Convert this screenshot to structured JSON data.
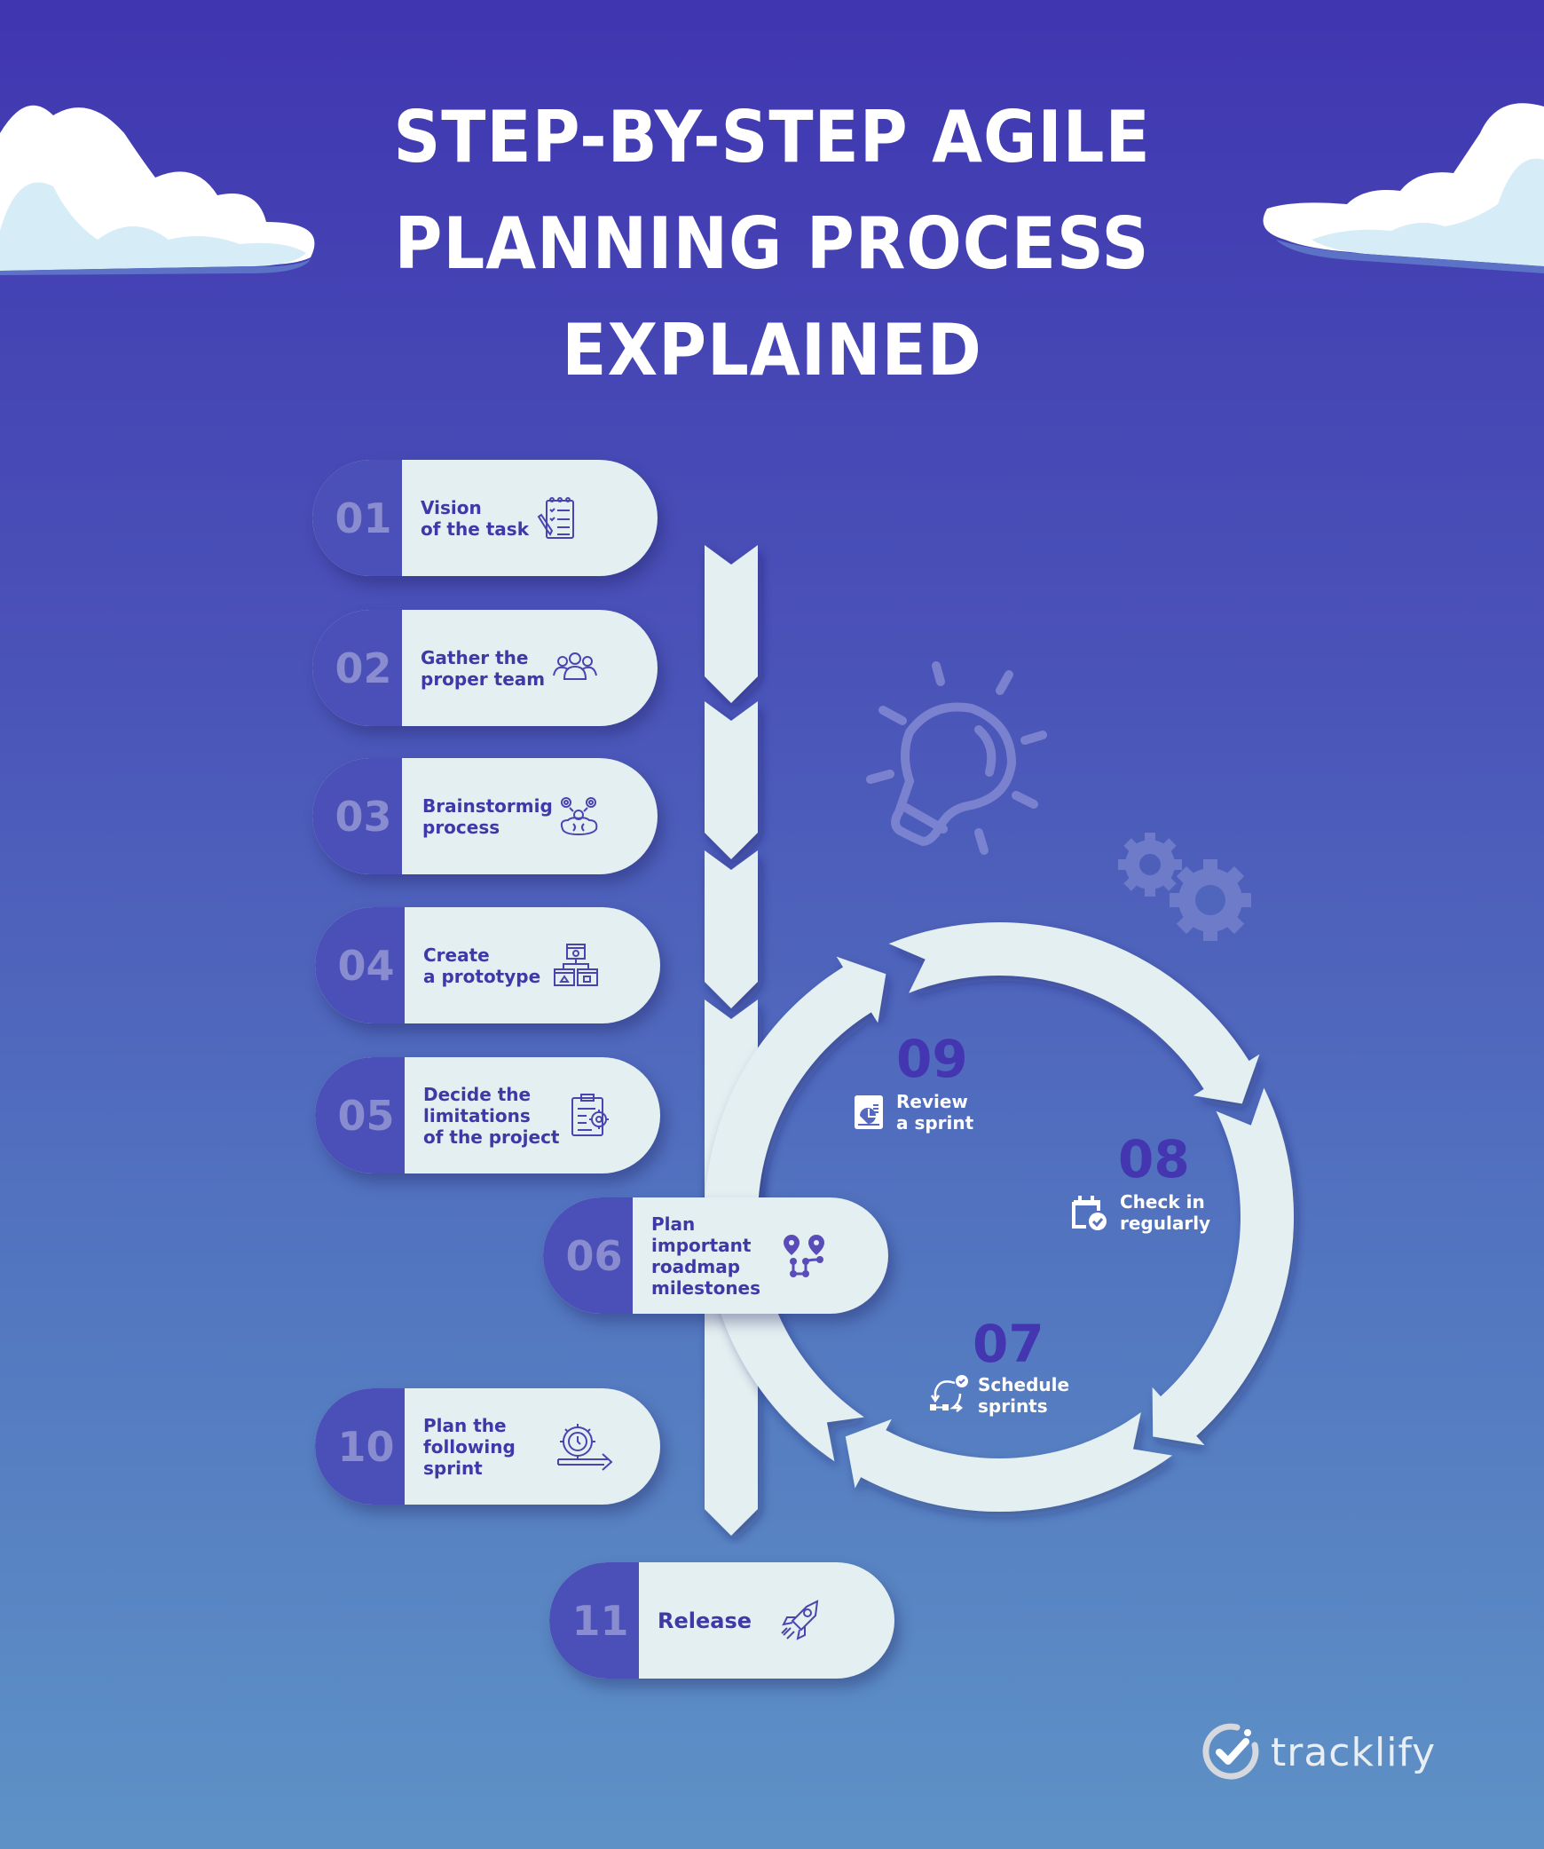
{
  "title": {
    "line1": "STEP-BY-STEP AGILE",
    "line2": "PLANNING PROCESS",
    "line3": "EXPLAINED"
  },
  "steps": [
    {
      "num": "01",
      "lines": [
        "Vision",
        "of the task"
      ],
      "icon": "checklist-notepad-icon"
    },
    {
      "num": "02",
      "lines": [
        "Gather the",
        "proper team"
      ],
      "icon": "team-people-icon"
    },
    {
      "num": "03",
      "lines": [
        "Brainstormig",
        "process"
      ],
      "icon": "brain-gears-icon"
    },
    {
      "num": "04",
      "lines": [
        "Create",
        "a prototype"
      ],
      "icon": "prototype-hierarchy-icon"
    },
    {
      "num": "05",
      "lines": [
        "Decide the",
        "limitations",
        "of the project"
      ],
      "icon": "clipboard-gear-icon"
    },
    {
      "num": "06",
      "lines": [
        "Plan",
        "important",
        "roadmap",
        "milestones"
      ],
      "icon": "roadmap-pins-icon"
    },
    {
      "num": "10",
      "lines": [
        "Plan the",
        "following",
        "sprint"
      ],
      "icon": "gear-clock-arrow-icon"
    },
    {
      "num": "11",
      "lines": [
        "Release"
      ],
      "icon": "rocket-icon"
    }
  ],
  "cycle": [
    {
      "num": "07",
      "lines": [
        "Schedule",
        "sprints"
      ],
      "icon": "schedule-cycle-icon"
    },
    {
      "num": "08",
      "lines": [
        "Check in",
        "regularly"
      ],
      "icon": "calendar-check-icon"
    },
    {
      "num": "09",
      "lines": [
        "Review",
        "a sprint"
      ],
      "icon": "report-chart-icon"
    }
  ],
  "brand": {
    "name": "tracklify"
  },
  "colors": {
    "accent": "#4a50b8",
    "card": "#e3eff1",
    "text": "#3f38a8",
    "number": "#8a8cd0",
    "cycle_number": "#4336b0"
  }
}
